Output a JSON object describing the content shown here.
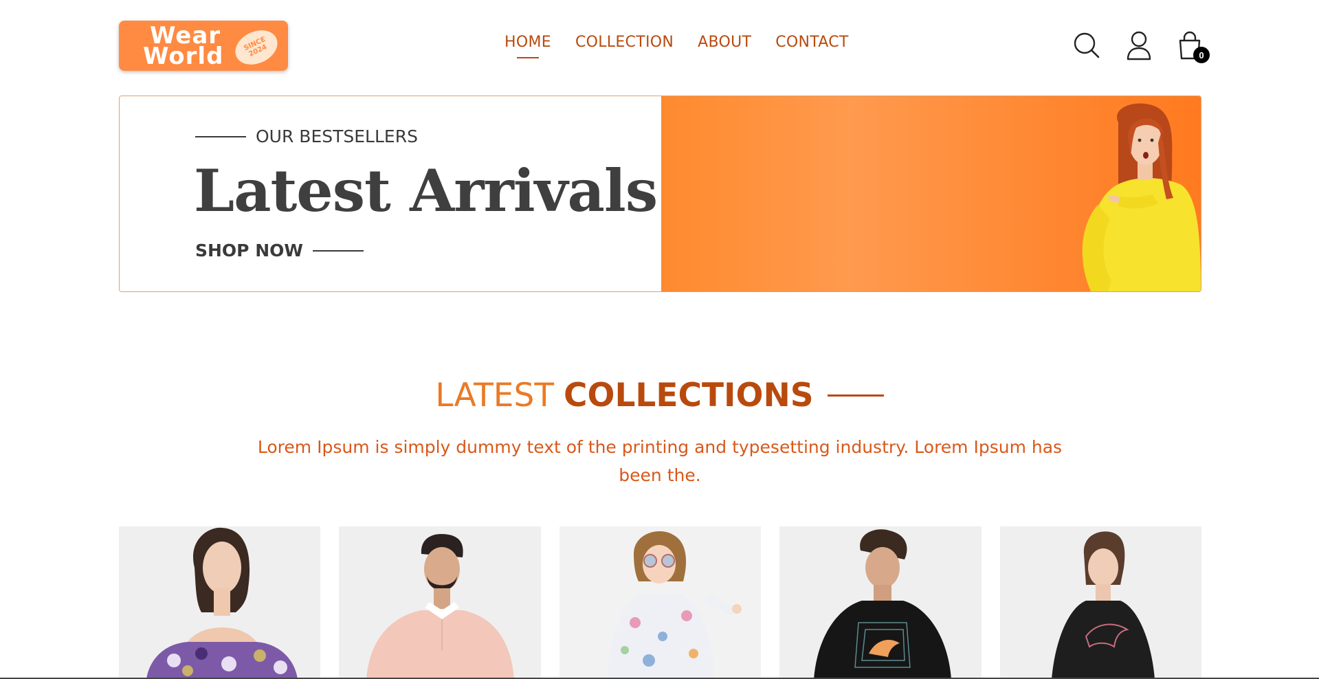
{
  "header": {
    "logo": {
      "line1": "Wear",
      "line2": "World",
      "badge_line1": "SINCE",
      "badge_line2": "2024"
    },
    "nav": [
      {
        "label": "HOME",
        "active": true
      },
      {
        "label": "COLLECTION",
        "active": false
      },
      {
        "label": "ABOUT",
        "active": false
      },
      {
        "label": "CONTACT",
        "active": false
      }
    ],
    "icons": {
      "search": "search-icon",
      "profile": "user-icon",
      "cart": "shopping-bag-icon"
    },
    "cart_count": "0"
  },
  "hero": {
    "eyebrow": "OUR BESTSELLERS",
    "title": "Latest Arrivals",
    "cta": "SHOP NOW",
    "accent_color": "#ff8a2e"
  },
  "section": {
    "title_part1": "LATEST",
    "title_part2": "COLLECTIONS",
    "description": "Lorem Ipsum is simply dummy text of the printing and typesetting industry. Lorem Ipsum has been the."
  },
  "products": [
    {
      "name": "product-floral-off-shoulder-top"
    },
    {
      "name": "product-pink-polo-shirt"
    },
    {
      "name": "product-kids-floral-dress"
    },
    {
      "name": "product-black-puma-tshirt-men"
    },
    {
      "name": "product-black-puma-tshirt-women"
    }
  ],
  "colors": {
    "brand": "#ff8a42",
    "nav": "#b94a0e",
    "accent_light": "#ea7a25"
  }
}
